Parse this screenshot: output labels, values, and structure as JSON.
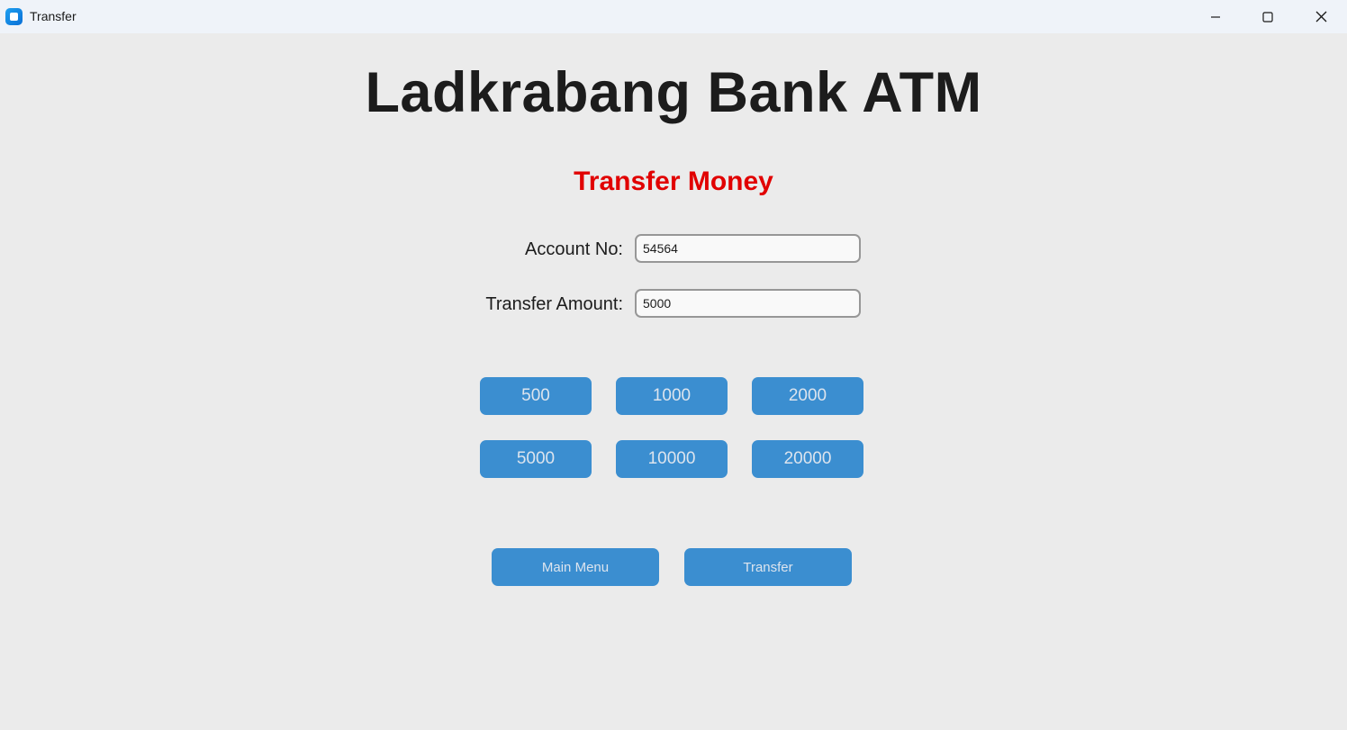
{
  "window": {
    "title": "Transfer"
  },
  "header": {
    "bank_title": "Ladkrabang Bank ATM",
    "subtitle": "Transfer Money",
    "subtitle_color": "#e10000"
  },
  "form": {
    "account_label": "Account No:",
    "account_value": "54564",
    "amount_label": "Transfer Amount:",
    "amount_value": "5000"
  },
  "quick_amounts": [
    "500",
    "1000",
    "2000",
    "5000",
    "10000",
    "20000"
  ],
  "actions": {
    "main_menu_label": "Main Menu",
    "transfer_label": "Transfer"
  },
  "colors": {
    "accent": "#3b8ed0",
    "button_text": "#dce4ee",
    "background": "#ebebeb"
  },
  "icons": {
    "app": "app-icon",
    "minimize": "minimize-icon",
    "maximize": "maximize-icon",
    "close": "close-icon"
  }
}
